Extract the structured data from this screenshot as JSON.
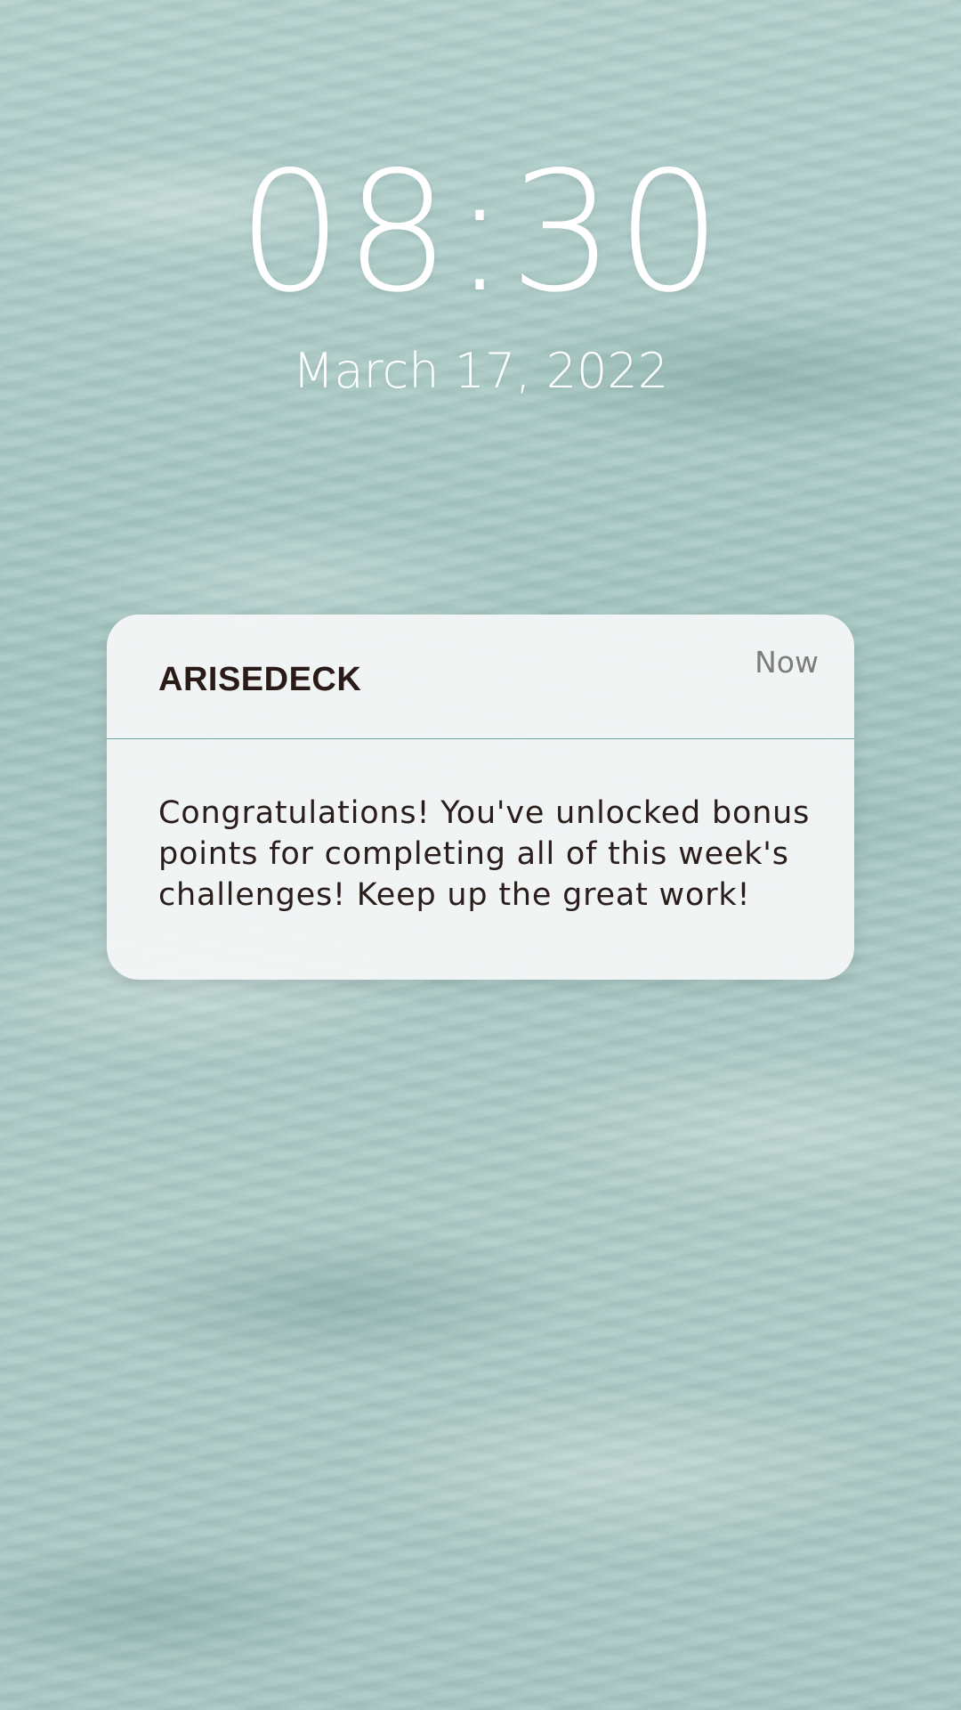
{
  "lockscreen": {
    "time": "08:30",
    "date": "March 17, 2022"
  },
  "notification": {
    "app_name": "ARISEDECK",
    "timestamp": "Now",
    "message": "Congratulations! You've unlocked bonus points for completing all of this week's challenges! Keep up the great work!"
  },
  "colors": {
    "background": "#a9c9c5",
    "card": "#f5f6f6",
    "divider": "#6aa7a2",
    "title_text": "#2a1a18"
  }
}
